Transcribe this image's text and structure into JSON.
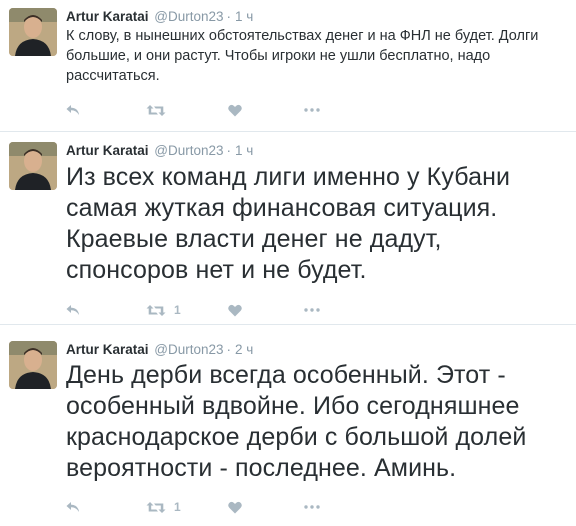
{
  "tweets": [
    {
      "name": "Artur Karatai",
      "handle": "@Durton23",
      "separator": "·",
      "time": "1 ч",
      "text": "К слову, в нынешних обстоятельствах денег и на ФНЛ не будет. Долги большие, и они растут. Чтобы игроки не ушли бесплатно, надо рассчитаться.",
      "retweets": "",
      "icons": [
        "reply-icon",
        "retweet-icon",
        "like-icon",
        "more-icon"
      ]
    },
    {
      "name": "Artur Karatai",
      "handle": "@Durton23",
      "separator": "·",
      "time": "1 ч",
      "text": "Из всех команд лиги именно у Кубани самая жуткая финансовая ситуация. Краевые власти денег не дадут, спонсоров нет и не будет.",
      "retweets": "1",
      "icons": [
        "reply-icon",
        "retweet-icon",
        "like-icon",
        "more-icon"
      ]
    },
    {
      "name": "Artur Karatai",
      "handle": "@Durton23",
      "separator": "·",
      "time": "2 ч",
      "text": "День дерби всегда особенный. Этот - особенный вдвойне. Ибо сегодняшнее краснодарское дерби с большой долей вероятности - последнее. Аминь.",
      "retweets": "1",
      "icons": [
        "reply-icon",
        "retweet-icon",
        "like-icon",
        "more-icon"
      ]
    }
  ],
  "colors": {
    "text": "#292f33",
    "meta": "#8899a6",
    "action": "#aab8c2",
    "divider": "#e1e8ed"
  }
}
